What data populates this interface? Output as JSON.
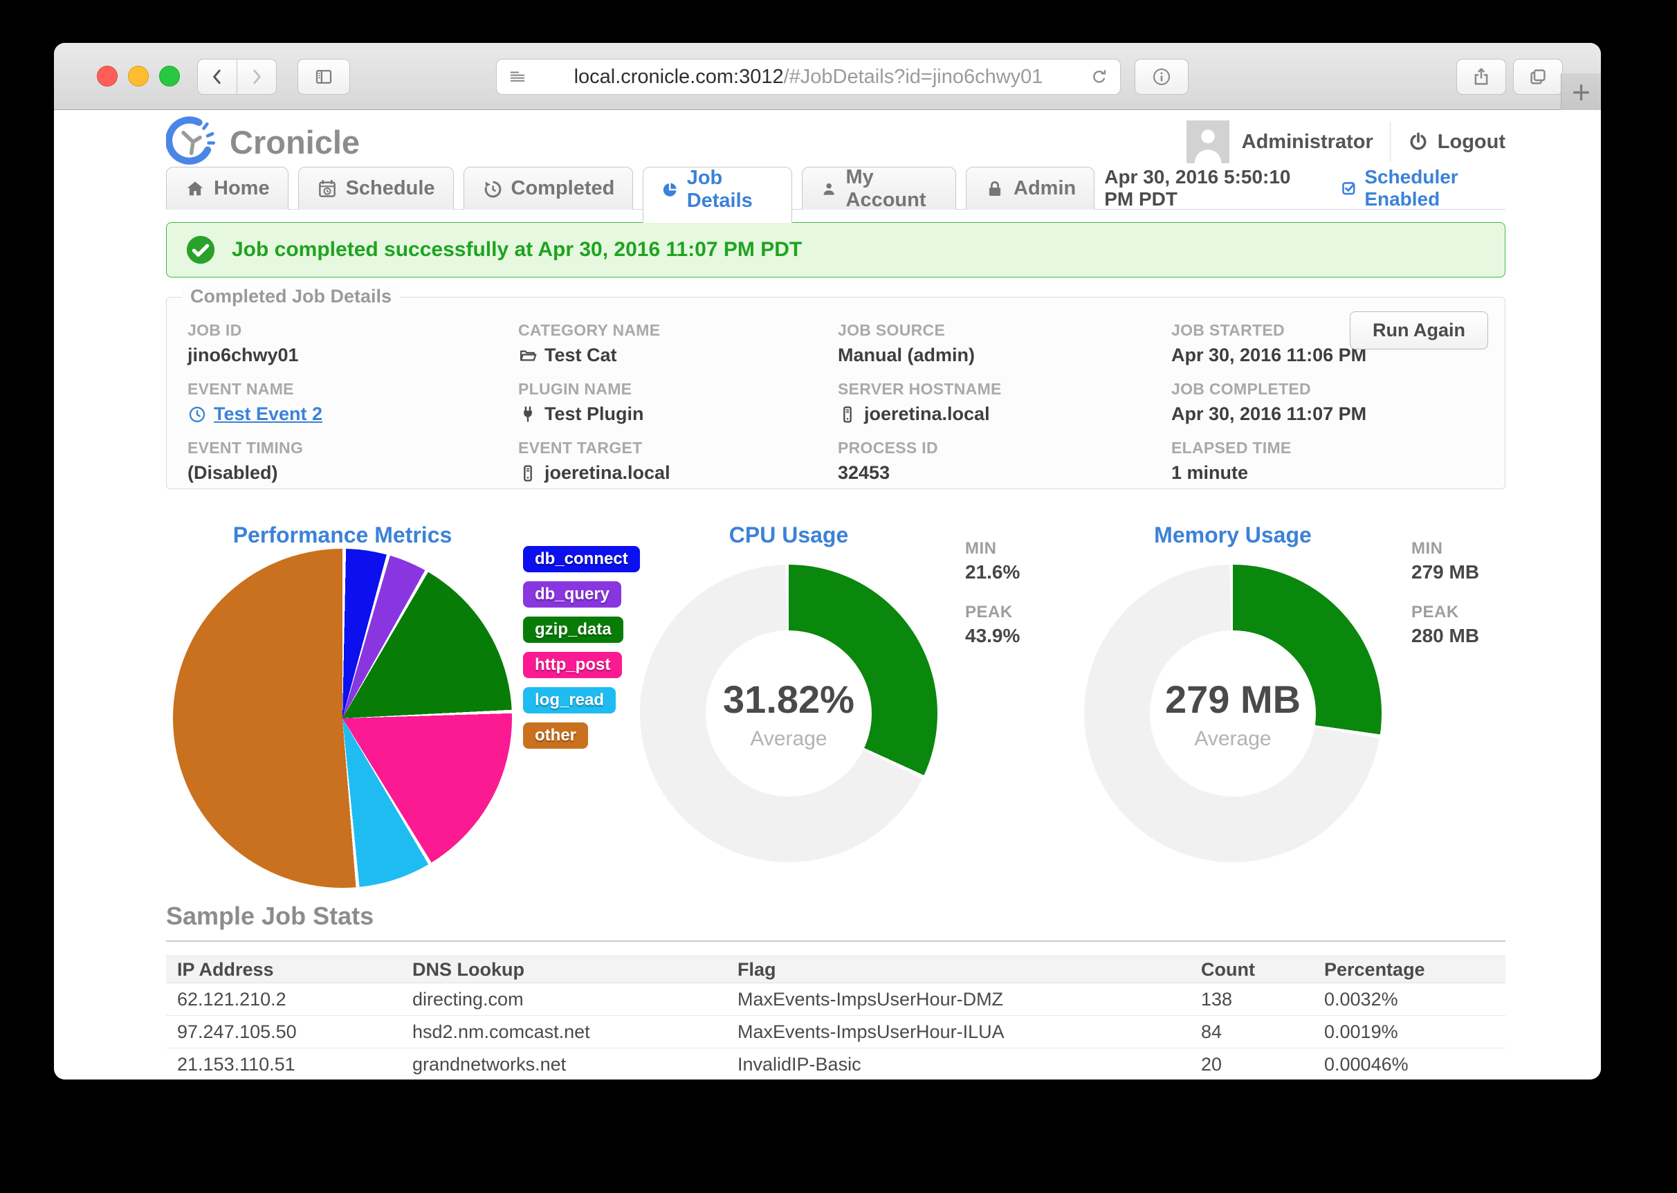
{
  "browser": {
    "url_host": "local.cronicle.com:3012",
    "url_path": "/#JobDetails?id=jino6chwy01",
    "new_tab_label": "+"
  },
  "header": {
    "app_name": "Cronicle",
    "user_name": "Administrator",
    "logout_label": "Logout"
  },
  "nav": {
    "tabs": [
      {
        "label": "Home"
      },
      {
        "label": "Schedule"
      },
      {
        "label": "Completed"
      },
      {
        "label": "Job Details"
      },
      {
        "label": "My Account"
      },
      {
        "label": "Admin"
      }
    ],
    "active_tab": "Job Details",
    "datetime": "Apr 30, 2016 5:50:10 PM PDT",
    "scheduler_label": "Scheduler Enabled"
  },
  "banner": {
    "message": "Job completed successfully at Apr 30, 2016 11:07 PM PDT"
  },
  "details": {
    "legend": "Completed Job Details",
    "run_again_label": "Run Again",
    "fields": [
      {
        "label": "JOB ID",
        "value": "jino6chwy01"
      },
      {
        "label": "CATEGORY NAME",
        "value": "Test Cat"
      },
      {
        "label": "JOB SOURCE",
        "value": "Manual (admin)"
      },
      {
        "label": "JOB STARTED",
        "value": "Apr 30, 2016 11:06 PM"
      },
      {
        "label": "EVENT NAME",
        "value": "Test Event 2"
      },
      {
        "label": "PLUGIN NAME",
        "value": "Test Plugin"
      },
      {
        "label": "SERVER HOSTNAME",
        "value": "joeretina.local"
      },
      {
        "label": "JOB COMPLETED",
        "value": "Apr 30, 2016 11:07 PM"
      },
      {
        "label": "EVENT TIMING",
        "value": "(Disabled)"
      },
      {
        "label": "EVENT TARGET",
        "value": "joeretina.local"
      },
      {
        "label": "PROCESS ID",
        "value": "32453"
      },
      {
        "label": "ELAPSED TIME",
        "value": "1 minute"
      }
    ]
  },
  "charts": {
    "pie_title": "Performance Metrics",
    "cpu_title": "CPU Usage",
    "mem_title": "Memory Usage",
    "cpu": {
      "min_label": "MIN",
      "min": "21.6%",
      "peak_label": "PEAK",
      "peak": "43.9%",
      "average": "31.82%",
      "average_label": "Average"
    },
    "mem": {
      "min_label": "MIN",
      "min": "279 MB",
      "peak_label": "PEAK",
      "peak": "280 MB",
      "average": "279 MB",
      "average_label": "Average"
    }
  },
  "chart_data": [
    {
      "type": "pie",
      "title": "Performance Metrics",
      "labels": [
        "db_connect",
        "db_query",
        "gzip_data",
        "http_post",
        "log_read",
        "other"
      ],
      "values": [
        4.2,
        3.9,
        16.1,
        17.0,
        7.2,
        51.6
      ],
      "units": "percent of total job time (estimated from slice angles)",
      "colors": [
        "#0c10ee",
        "#8a36e0",
        "#077d07",
        "#fb1a92",
        "#1fbcf2",
        "#c9711f"
      ],
      "legend_position": "right"
    },
    {
      "type": "donut",
      "title": "CPU Usage",
      "center_value": "31.82%",
      "center_label": "Average",
      "min": "21.6%",
      "peak": "43.9%",
      "fill_pct_of_circle": 31.82,
      "color": "#0a870d",
      "track_color": "#f1f1f1"
    },
    {
      "type": "donut",
      "title": "Memory Usage",
      "center_value": "279 MB",
      "center_label": "Average",
      "min": "279 MB",
      "peak": "280 MB",
      "fill_pct_of_circle": 27.25,
      "color": "#0a870d",
      "track_color": "#f1f1f1"
    }
  ],
  "stats": {
    "heading": "Sample Job Stats",
    "columns": [
      "IP Address",
      "DNS Lookup",
      "Flag",
      "Count",
      "Percentage"
    ],
    "rows": [
      [
        "62.121.210.2",
        "directing.com",
        "MaxEvents-ImpsUserHour-DMZ",
        "138",
        "0.0032%"
      ],
      [
        "97.247.105.50",
        "hsd2.nm.comcast.net",
        "MaxEvents-ImpsUserHour-ILUA",
        "84",
        "0.0019%"
      ],
      [
        "21.153.110.51",
        "grandnetworks.net",
        "InvalidIP-Basic",
        "20",
        "0.00046%"
      ]
    ]
  },
  "colors": {
    "accent_blue": "#3b82d8",
    "success_green": "#1fa31f",
    "donut_green": "#0a870d"
  }
}
